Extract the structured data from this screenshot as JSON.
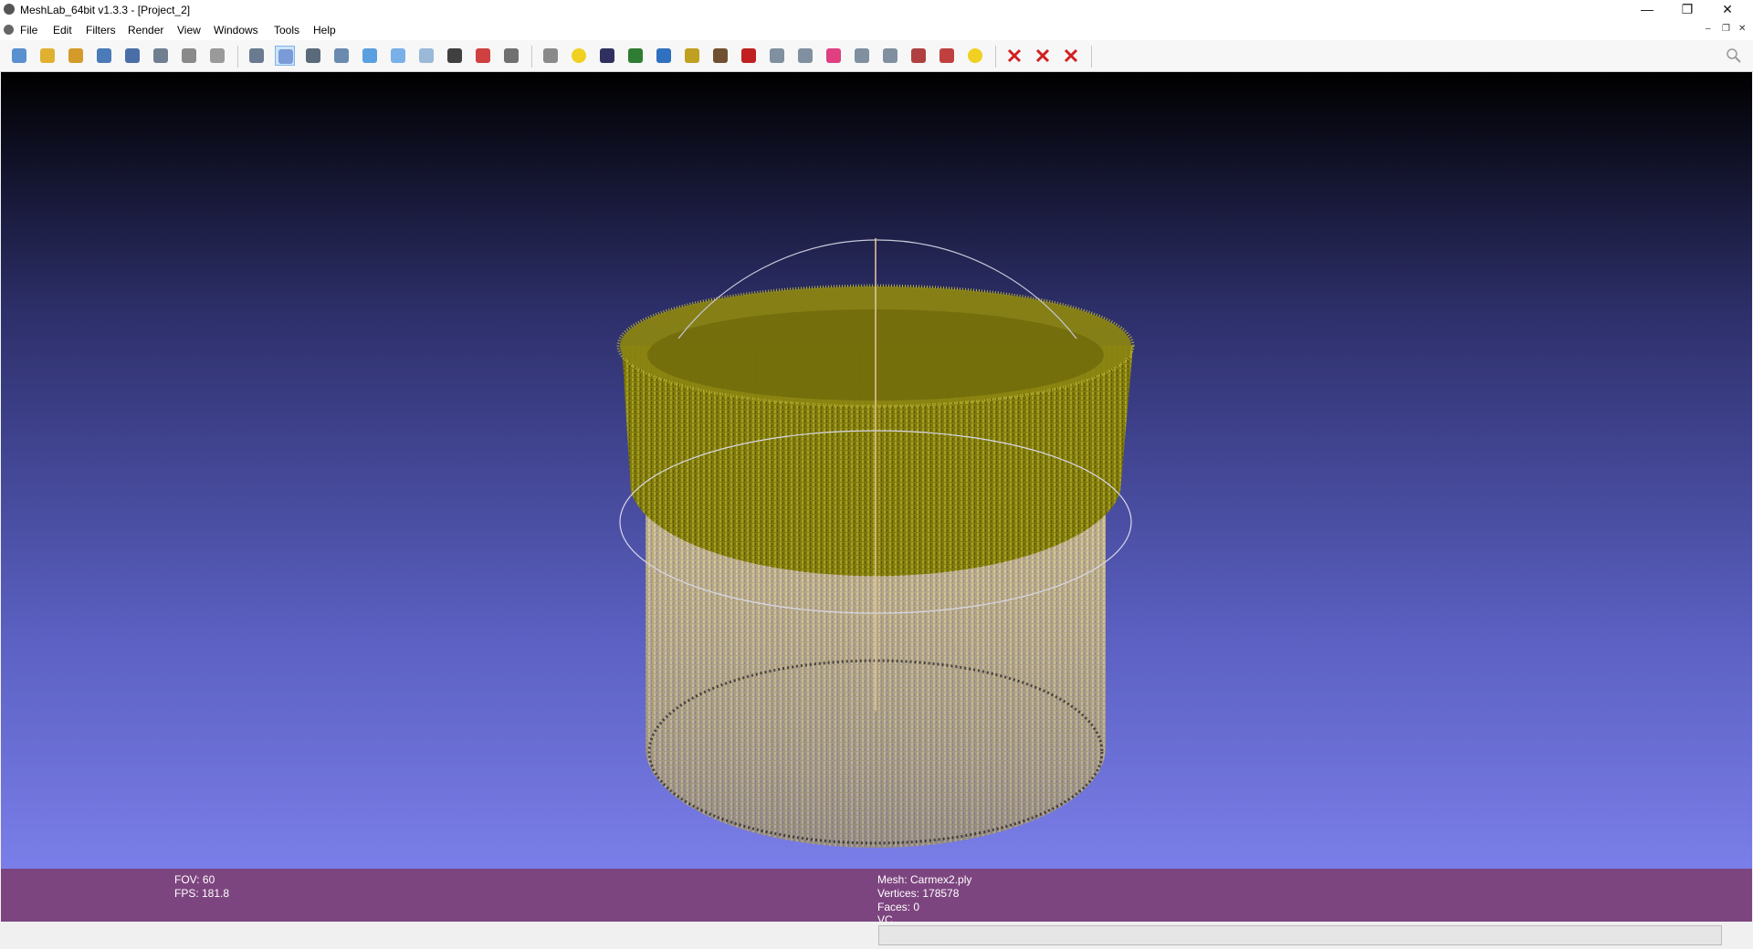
{
  "window": {
    "title": "MeshLab_64bit v1.3.3 - [Project_2]",
    "controls": {
      "minimize": "—",
      "restore": "❐",
      "close": "✕"
    },
    "mdi_controls": {
      "minimize": "–",
      "restore": "❐",
      "close": "✕"
    }
  },
  "menu": [
    "File",
    "Edit",
    "Filters",
    "Render",
    "View",
    "Windows",
    "Tools",
    "Help"
  ],
  "toolbar": {
    "icons": [
      "new-project-icon",
      "open-project-icon",
      "open-mesh-icon",
      "reload-icon",
      "save-icon",
      "snapshot-icon",
      "layers-icon",
      "sphere-render-icon",
      "bounding-box-icon",
      "points-icon",
      "wireframe-icon",
      "flat-lines-icon",
      "flat-icon",
      "smooth-icon",
      "texture-icon",
      "light-icon",
      "double-side-icon",
      "back-face-icon",
      "trackball-icon",
      "annotation-icon",
      "image-alignment-icon",
      "texture-paint-icon",
      "measure-icon",
      "paint-brush-icon",
      "brush-icon",
      "pick-points-icon",
      "quality-icon",
      "vertex-select-icon",
      "color-icon",
      "reference-icon",
      "select-faces-icon",
      "select-area-icon",
      "select-connected-icon",
      "info-icon",
      "delete-vertices-icon",
      "delete-faces-icon",
      "delete-all-icon"
    ],
    "selected": "points-icon",
    "search_icon": "search-icon"
  },
  "status": {
    "fov": "FOV: 60",
    "fps": "FPS:   181.8",
    "mesh": "Mesh: Carmex2.ply",
    "vertices": "Vertices: 178578",
    "faces": "Faces: 0",
    "vc": "VC"
  },
  "colors": {
    "status_bg": "#7d4580",
    "mesh_top": "#8f8a14",
    "mesh_bottom": "#c9b98a",
    "trackball": "#c8c8d8"
  }
}
